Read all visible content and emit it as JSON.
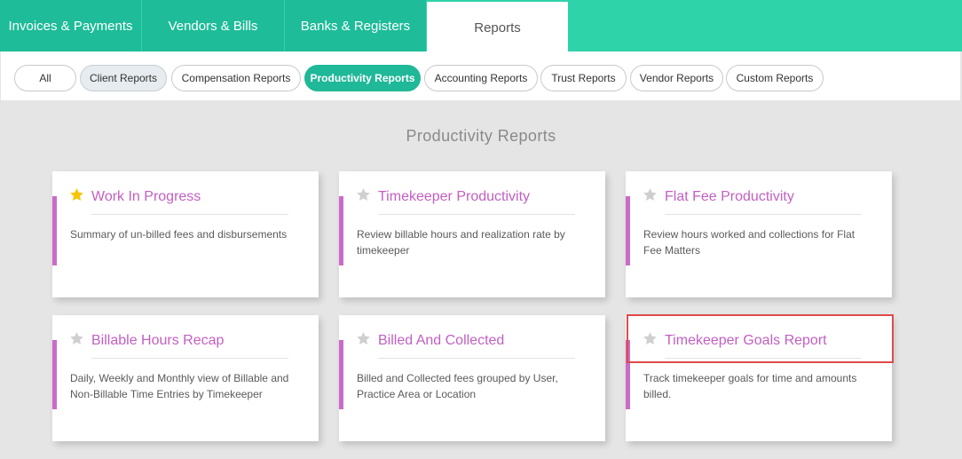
{
  "top_tabs": [
    {
      "label": "Invoices & Payments"
    },
    {
      "label": "Vendors & Bills"
    },
    {
      "label": "Banks & Registers"
    },
    {
      "label": "Reports"
    }
  ],
  "filters": [
    {
      "label": "All"
    },
    {
      "label": "Client Reports"
    },
    {
      "label": "Compensation Reports"
    },
    {
      "label": "Productivity Reports"
    },
    {
      "label": "Accounting Reports"
    },
    {
      "label": "Trust Reports"
    },
    {
      "label": "Vendor Reports"
    },
    {
      "label": "Custom Reports"
    }
  ],
  "section_title": "Productivity Reports",
  "colors": {
    "accent_green": "#2fd3aa",
    "active_filter": "#1fb898",
    "card_title": "#c25fc2",
    "card_bar": "#c86cc8",
    "star_favorite": "#f7c500",
    "star_default": "#cfcfcf",
    "highlight_border": "#df4a4a"
  },
  "reports": [
    {
      "title": "Work In Progress",
      "description": "Summary of un-billed fees and disbursements",
      "favorite": true,
      "icon": "star-filled-icon"
    },
    {
      "title": "Timekeeper Productivity",
      "description": "Review billable hours and realization rate by timekeeper",
      "favorite": false,
      "icon": "star-icon"
    },
    {
      "title": "Flat Fee Productivity",
      "description": "Review hours worked and collections for Flat Fee Matters",
      "favorite": false,
      "icon": "star-icon"
    },
    {
      "title": "Billable Hours Recap",
      "description": "Daily, Weekly and Monthly view of Billable and Non-Billable Time Entries by Timekeeper",
      "favorite": false,
      "icon": "star-icon"
    },
    {
      "title": "Billed And Collected",
      "description": "Billed and Collected fees grouped by User, Practice Area or Location",
      "favorite": false,
      "icon": "star-icon"
    },
    {
      "title": "Timekeeper Goals Report",
      "description": "Track timekeeper goals for time and amounts billed.",
      "favorite": false,
      "icon": "star-icon"
    }
  ]
}
